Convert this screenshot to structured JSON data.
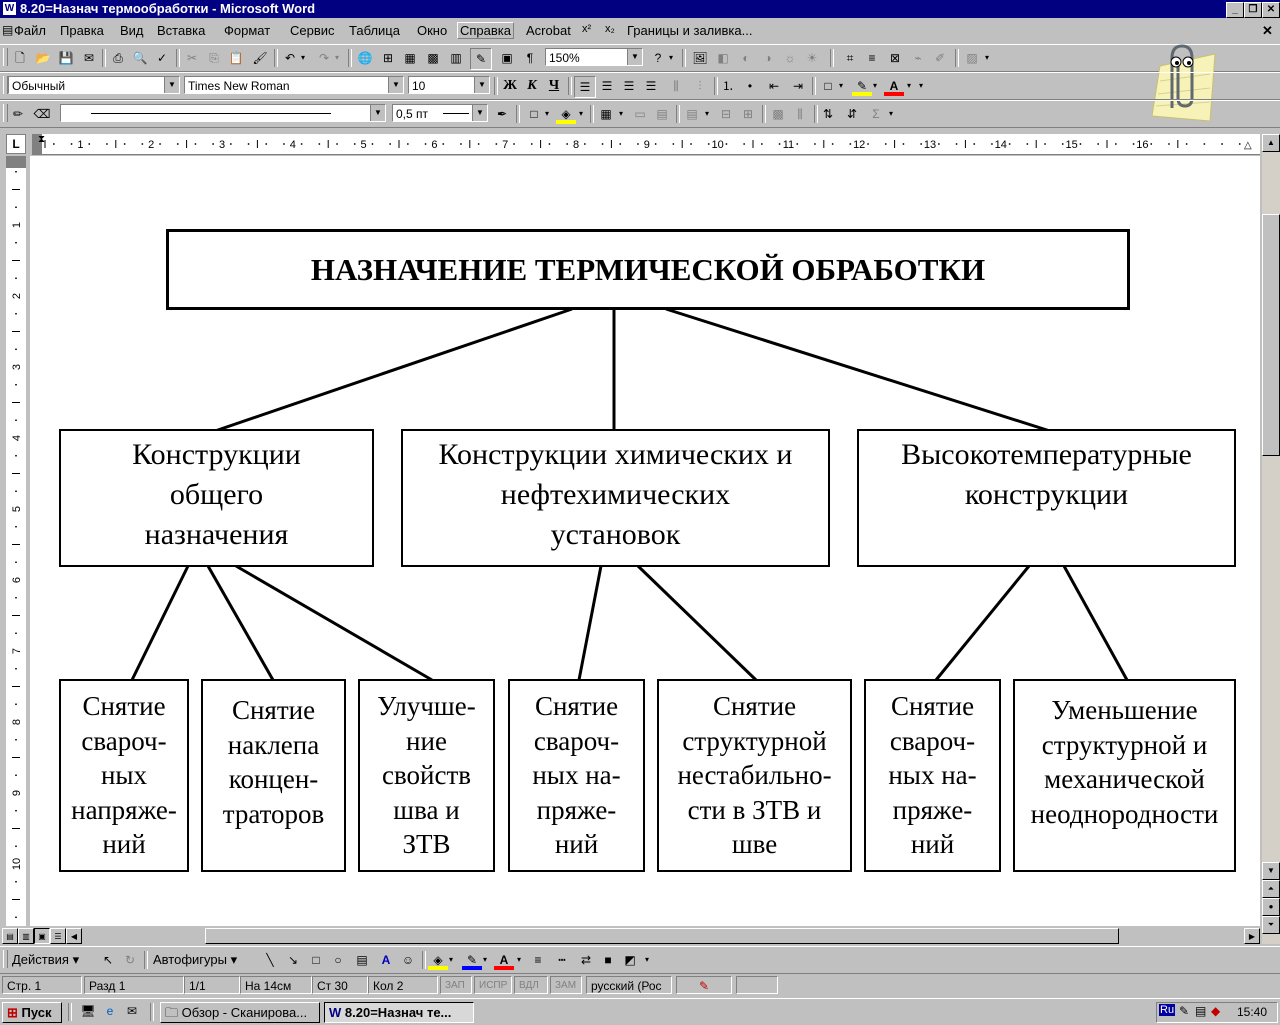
{
  "window": {
    "title": "8.20=Назнач термообработки - Microsoft Word"
  },
  "menu": [
    "Файл",
    "Правка",
    "Вид",
    "Вставка",
    "Формат",
    "Сервис",
    "Таблица",
    "Окно",
    "Справка",
    "Acrobat",
    "x²",
    "x₂",
    "Границы и заливка..."
  ],
  "toolbar_std": {
    "zoom": "150%"
  },
  "toolbar_fmt": {
    "style": "Обычный",
    "font": "Times New Roman",
    "size": "10",
    "bold": "Ж",
    "italic": "К",
    "underline": "Ч"
  },
  "toolbar_tables": {
    "line_width": "0,5 пт"
  },
  "ruler_numbers": [
    "1",
    "2",
    "3",
    "4",
    "5",
    "6",
    "7",
    "8",
    "9",
    "10",
    "11",
    "12",
    "13",
    "14",
    "15",
    "16"
  ],
  "diagram": {
    "title": "НАЗНАЧЕНИЕ ТЕРМИЧЕСКОЙ ОБРАБОТКИ",
    "categories": [
      {
        "label": "Конструкции\nобщего\nназначения"
      },
      {
        "label": "Конструкции химических и\nнефтехимических\nустановок"
      },
      {
        "label": "Высокотемпературные\nконструкции"
      }
    ],
    "leaves": [
      {
        "label": "Снятие\nсвароч-\nных\nнапряже-\nний"
      },
      {
        "label": "Снятие\nнаклепа\nконцен-\nтраторов"
      },
      {
        "label": "Улучше-\nние\nсвойств\nшва и\nЗТВ"
      },
      {
        "label": "Снятие\nсвароч-\nных на-\nпряже-\nний"
      },
      {
        "label": "Снятие\nструктурной\nнестабильно-\nсти в ЗТВ и\nшве"
      },
      {
        "label": "Снятие\nсвароч-\nных на-\nпряже-\nний"
      },
      {
        "label": "Уменьшение\nструктурной и\nмеханической\nнеоднородности"
      }
    ]
  },
  "drawing": {
    "actions": "Действия",
    "autoshapes": "Автофигуры"
  },
  "status": {
    "page": "Стр. 1",
    "section": "Разд 1",
    "pages": "1/1",
    "at": "На 14см",
    "line": "Ст 30",
    "col": "Кол 2",
    "rec": "ЗАП",
    "trk": "ИСПР",
    "ext": "ВДЛ",
    "ovr": "ЗАМ",
    "lang": "русский (Рос"
  },
  "taskbar": {
    "start": "Пуск",
    "task1": "Обзор - Сканирова...",
    "task2": "8.20=Назнач те...",
    "tray_lang": "Ru",
    "time": "15:40"
  }
}
